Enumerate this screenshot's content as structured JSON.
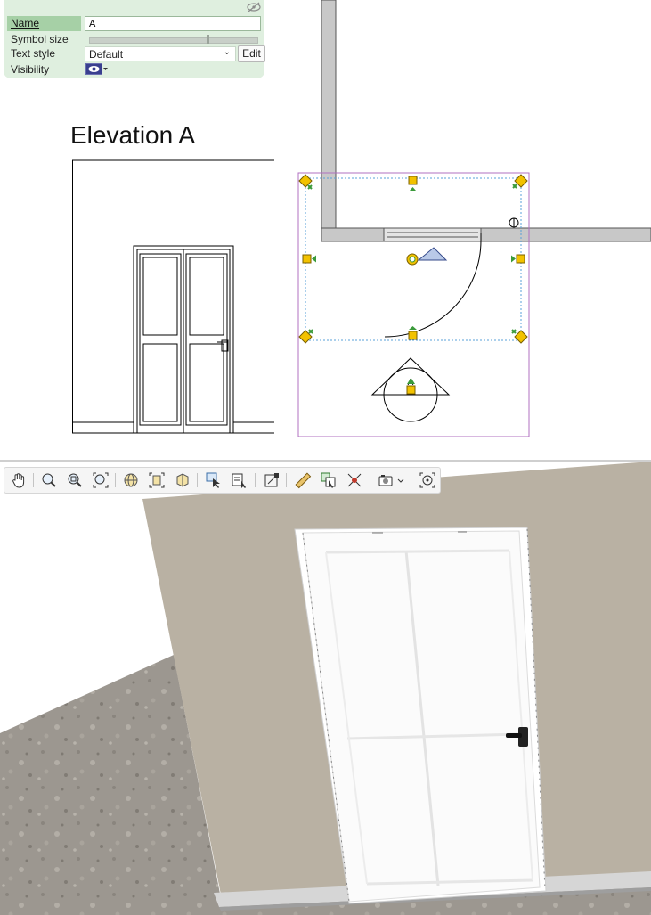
{
  "properties": {
    "name_label": "Name",
    "name_value": "A",
    "symbol_size_label": "Symbol size",
    "symbol_size_value": 0.7,
    "text_style_label": "Text style",
    "text_style_value": "Default",
    "edit_label": "Edit",
    "visibility_label": "Visibility",
    "hide_icon": "eye-slash-icon"
  },
  "elevation": {
    "title": "Elevation A"
  },
  "toolbar": {
    "icons": [
      "hand-pan-icon",
      "zoom-icon",
      "zoom-window-icon",
      "zoom-extents-icon",
      "orbit-globe-icon",
      "fit-selection-icon",
      "box-section-icon",
      "select-arrow-icon",
      "select-list-icon",
      "scale-frame-icon",
      "measure-ruler-icon",
      "copy-select-icon",
      "delete-cross-icon",
      "camera-icon",
      "target-view-icon"
    ]
  },
  "colors": {
    "panel_bg": "#dfefdf",
    "grip_yellow": "#f2c200",
    "selection_purple": "#b070c0",
    "wall_grey": "#c8c8c8",
    "wall3d_taupe": "#b9b1a3",
    "floor_stone": "#9c9790"
  }
}
